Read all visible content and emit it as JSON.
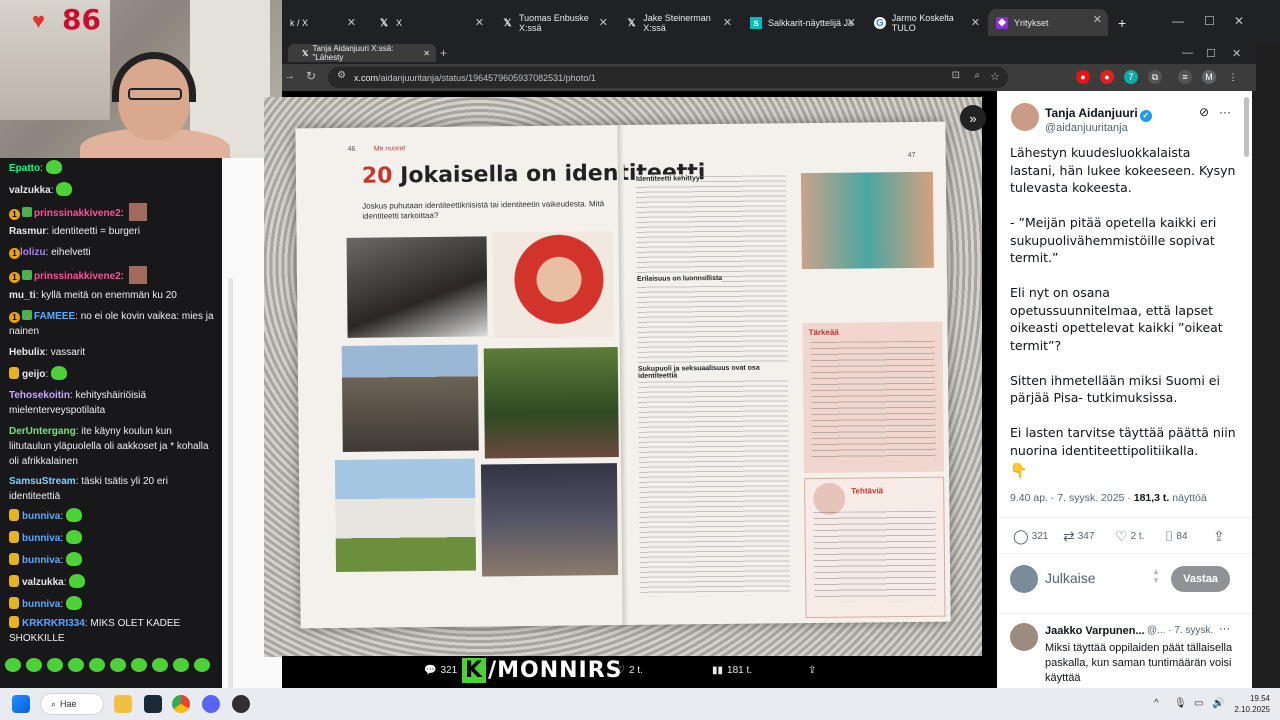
{
  "browser": {
    "tabs": [
      {
        "title": "k / X",
        "icon": "x-icon"
      },
      {
        "title": "X",
        "icon": "x-icon"
      },
      {
        "title": "Tuomas Enbuske X:ssä",
        "icon": "x-icon"
      },
      {
        "title": "Jake Steinerman X:ssä",
        "icon": "x-icon"
      },
      {
        "title": "Salkkarit-näyttelijä Ja",
        "icon": "news-icon"
      },
      {
        "title": "Jarmo Koskelta TULO",
        "icon": "google-icon"
      },
      {
        "title": "Yritykset",
        "icon": "shield-icon"
      }
    ],
    "new_tab": "+",
    "inner_tab_title": "Tanja Aidanjuuri X:ssä: \"Lähesty",
    "url_host": "x.com",
    "url_path": "/aidanjuuritanja/status/1964579605937082531/photo/1"
  },
  "stream": {
    "heart_rate": "86",
    "overlay_text": "/MONNIRS",
    "overlay_k": "K"
  },
  "chat": [
    {
      "user": "Epatto",
      "color": "#00ff7f",
      "text": "",
      "emote": true
    },
    {
      "user": "valzukka",
      "color": "#e8e8e8",
      "text": "",
      "emote": true
    },
    {
      "user": "prinssinakkivene2",
      "color": "#ff4f9a",
      "text": "",
      "badges": true,
      "avatar": true
    },
    {
      "user": "Rasmur",
      "color": "#e8e8e8",
      "text": "identiteetti = burgeri"
    },
    {
      "user": "lolizu",
      "color": "#b57cff",
      "text": "eihelvetti",
      "badge1": true
    },
    {
      "user": "prinssinakkivene2",
      "color": "#ff4f9a",
      "text": "",
      "badges": true,
      "avatar": true
    },
    {
      "user": "mu_ti",
      "color": "#e8e8e8",
      "text": "kyllä meitä on enemmän ku 20"
    },
    {
      "user": "FAMEEE",
      "color": "#5aa9ff",
      "text": "no ei ole kovin vaikea: mies ja nainen",
      "badges": true
    },
    {
      "user": "Hebulix",
      "color": "#e8e8e8",
      "text": "vassarit"
    },
    {
      "user": "geijo",
      "color": "#e8e8e8",
      "text": "",
      "gold": true,
      "emote": true
    },
    {
      "user": "Tehosekoitin",
      "color": "#c9a7ff",
      "text": "kehityshäiriöisiä mielenterveyspotilaita"
    },
    {
      "user": "DerUntergang",
      "color": "#7ee07e",
      "text": "ite käyny koulun kun liitutaulun yläpuolella oli aakkoset ja * kohalla oli afrikkalainen"
    },
    {
      "user": "SamsuStream",
      "color": "#7fd4ff",
      "text": "täski tsätis yli 20 eri identiteettiä"
    },
    {
      "user": "bunniva",
      "color": "#5aa9ff",
      "text": "",
      "gold": true,
      "emote": true
    },
    {
      "user": "bunniva",
      "color": "#5aa9ff",
      "text": "",
      "gold": true,
      "emote": true
    },
    {
      "user": "bunniva",
      "color": "#5aa9ff",
      "text": "",
      "gold": true,
      "emote": true
    },
    {
      "user": "valzukka",
      "color": "#e8e8e8",
      "text": "",
      "gold": true,
      "emote": true
    },
    {
      "user": "bunniva",
      "color": "#5aa9ff",
      "text": "",
      "gold": true,
      "emote": true
    },
    {
      "user": "KRKRKRI334",
      "color": "#5aa9ff",
      "text": "MIKS OLET KADEE SHOKKILLE",
      "gold": true
    }
  ],
  "book": {
    "page_left": "46",
    "page_right": "47",
    "section": "Me nuoret",
    "chapter_num": "20",
    "chapter_title": "Jokaisella on identiteetti",
    "intro": "Joskus puhutaan identiteettikriisistä tai identiteetin vaikeudesta. Mitä identiteetti tarkoittaa?",
    "h1": "Identiteetti kehittyy",
    "h2": "Erilaisuus on luonnollista",
    "h3": "Sukupuoli ja seksuaalisuus ovat osa identiteettiä",
    "important": "Tärkeää",
    "tasks": "Tehtäviä"
  },
  "viewer_bar": {
    "replies": "321",
    "likes": "2 t.",
    "views": "181 t."
  },
  "tweet": {
    "author": "Tanja Aidanjuuri",
    "handle": "@aidanjuuritanja",
    "text": "Lähestyn kuudesluokkalaista lastani, hän lukee kokeeseen. Kysyn tulevasta kokeesta.\n\n- ”Meijän pitää opetella kaikki eri sukupuolivähemmistöille sopivat termit.”\n\nEli nyt on osana opetussuunnitelmaa, että lapset oikeasti opettelevat kaikki ”oikeat termit”?\n\nSitten ihmetellään miksi Suomi ei pärjää Pisa- tutkimuksissa.\n\nEi lasten tarvitse täyttää päättä niin nuorina identiteettipolitiikalla.",
    "emoji": "👇",
    "time": "9.40 ap. · 7. syysk. 2025 · ",
    "views_count": "181,3 t.",
    "views_label": " näyttöä",
    "replies": "321",
    "retweets": "347",
    "likes": "2 t.",
    "bookmarks": "84",
    "reply_placeholder": "Julkaise",
    "reply_button": "Vastaa",
    "comment_author": "Jaakko Varpunen...",
    "comment_meta": "@... · 7. syysk.",
    "comment_text": "Miksi täyttää oppilaiden päät tällaisella paskalla, kun saman tuntimäärän voisi käyttää"
  },
  "taskbar": {
    "search": "Hae",
    "time": "19.54",
    "date": "2.10.2025"
  }
}
